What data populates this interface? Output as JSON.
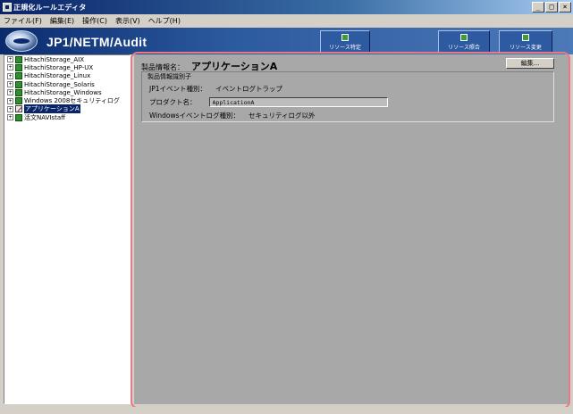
{
  "window": {
    "title": "正規化ルールエディタ",
    "controls": {
      "minimize": "_",
      "maximize": "□",
      "close": "×"
    }
  },
  "menu": {
    "items": [
      "ファイル(F)",
      "編集(E)",
      "操作(C)",
      "表示(V)",
      "ヘルプ(H)"
    ]
  },
  "banner": {
    "brand": "JP1/NETM/Audit",
    "tool_buttons": [
      {
        "label": "リソース特定",
        "icon": "resource-identify-icon"
      },
      {
        "label": "リソース照合",
        "icon": "resource-match-icon"
      },
      {
        "label": "リソース変更",
        "icon": "resource-change-icon"
      }
    ]
  },
  "tree": {
    "expander": "+",
    "items": [
      {
        "label": "HitachiStorage_AIX",
        "icon": "node-icon"
      },
      {
        "label": "HitachiStorage_HP-UX",
        "icon": "node-icon"
      },
      {
        "label": "HitachiStorage_Linux",
        "icon": "node-icon"
      },
      {
        "label": "HitachiStorage_Solaris",
        "icon": "node-icon"
      },
      {
        "label": "HitachiStorage_Windows",
        "icon": "node-icon"
      },
      {
        "label": "Windows 2008セキュリティログ",
        "icon": "node-icon"
      },
      {
        "label": "アプリケーションA",
        "icon": "edit-icon",
        "selected": true
      },
      {
        "label": "活文NAVIstaff",
        "icon": "node-icon"
      }
    ]
  },
  "detail": {
    "product_name_label": "製品情報名：",
    "product_name_value": "アプリケーションA",
    "edit_button": "編集...",
    "group_title": "製品情報識別子",
    "jp1_event_type_label": "JP1イベント種別：",
    "jp1_event_type_value": "イベントログトラップ",
    "product_name_field_label": "プロダクト名：",
    "product_name_field_value": "ApplicationA",
    "windows_log_type_label": "Windowsイベントログ種別：",
    "windows_log_type_value": "セキュリティログ以外"
  },
  "colors": {
    "highlight": "#e87a86",
    "banner": "#0b2a6e",
    "selection": "#0a246a"
  }
}
